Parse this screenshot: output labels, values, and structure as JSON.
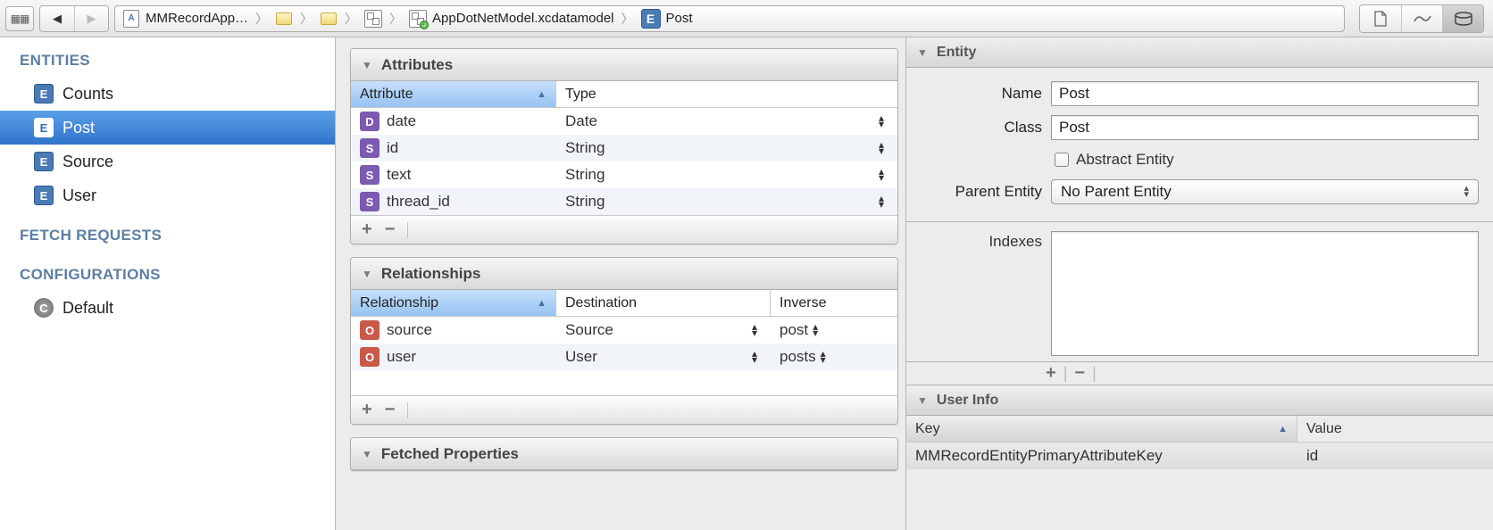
{
  "toolbar": {
    "breadcrumb": {
      "project": "MMRecordApp…",
      "model": "AppDotNetModel.xcdatamodel",
      "entity": "Post"
    }
  },
  "sidebar": {
    "sections": {
      "entities": "ENTITIES",
      "fetch": "FETCH REQUESTS",
      "config": "CONFIGURATIONS"
    },
    "entities": [
      "Counts",
      "Post",
      "Source",
      "User"
    ],
    "selected": "Post",
    "config_default": "Default"
  },
  "attributes": {
    "title": "Attributes",
    "cols": {
      "attr": "Attribute",
      "type": "Type"
    },
    "rows": [
      {
        "badge": "D",
        "name": "date",
        "type": "Date"
      },
      {
        "badge": "S",
        "name": "id",
        "type": "String"
      },
      {
        "badge": "S",
        "name": "text",
        "type": "String"
      },
      {
        "badge": "S",
        "name": "thread_id",
        "type": "String"
      }
    ]
  },
  "relationships": {
    "title": "Relationships",
    "cols": {
      "rel": "Relationship",
      "dest": "Destination",
      "inv": "Inverse"
    },
    "rows": [
      {
        "badge": "O",
        "name": "source",
        "dest": "Source",
        "inv": "post"
      },
      {
        "badge": "O",
        "name": "user",
        "dest": "User",
        "inv": "posts"
      }
    ]
  },
  "fetched": {
    "title": "Fetched Properties"
  },
  "inspector": {
    "entity_header": "Entity",
    "name_label": "Name",
    "name_value": "Post",
    "class_label": "Class",
    "class_value": "Post",
    "abstract_label": "Abstract Entity",
    "parent_label": "Parent Entity",
    "parent_value": "No Parent Entity",
    "indexes_label": "Indexes",
    "userinfo_header": "User Info",
    "kv_cols": {
      "key": "Key",
      "value": "Value"
    },
    "kv_row": {
      "key": "MMRecordEntityPrimaryAttributeKey",
      "value": "id"
    }
  }
}
